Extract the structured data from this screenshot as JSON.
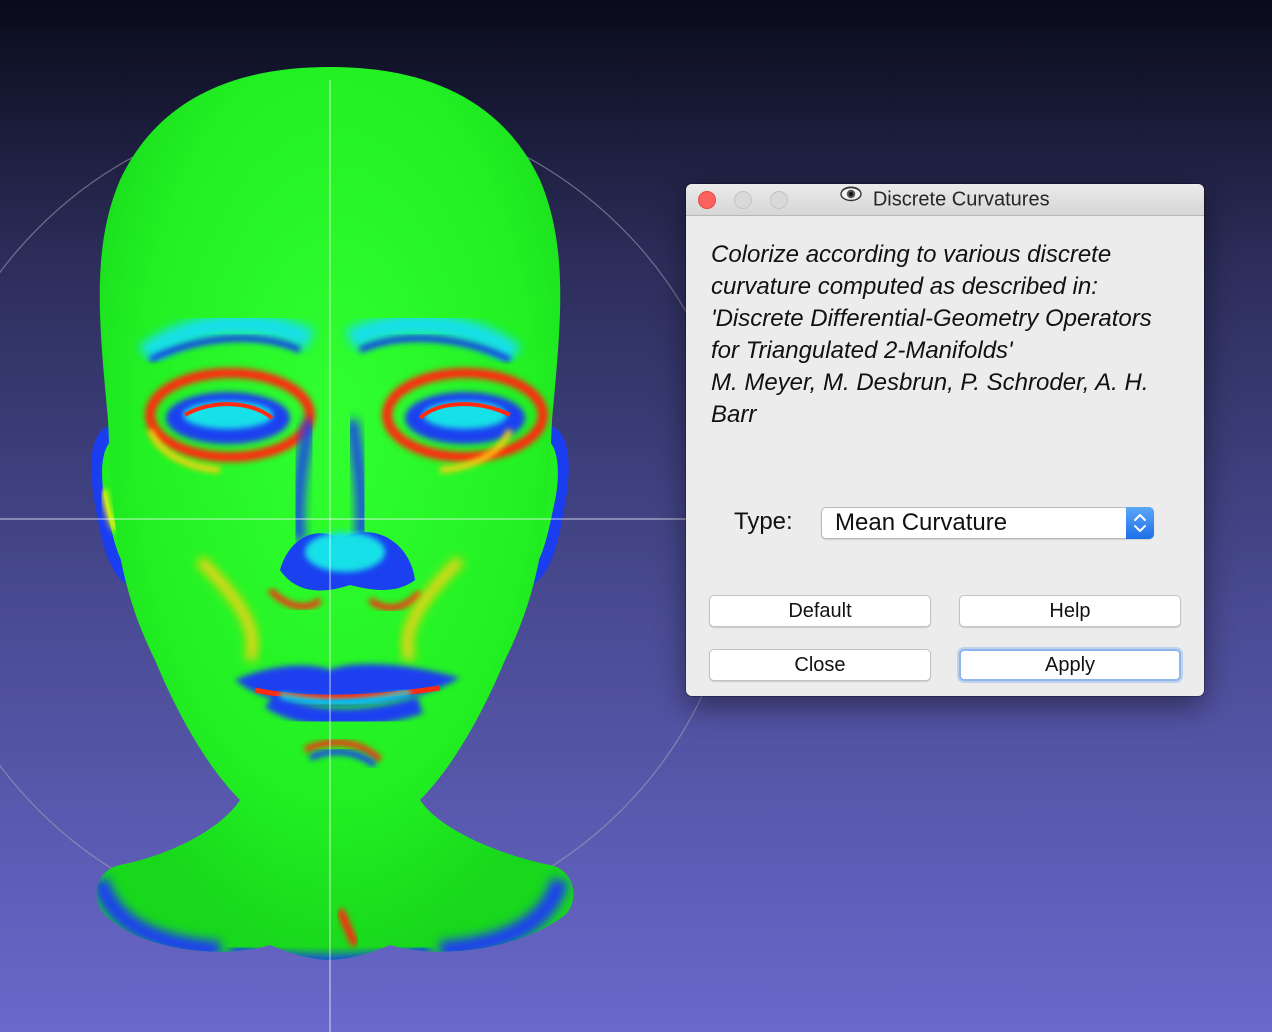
{
  "viewport": {
    "name": "3d-mesh-viewport",
    "colors": {
      "background_top": "#090b1a",
      "background_bottom": "#6a68cc",
      "base": "#22ee22",
      "highlight_red": "#ff2a10",
      "highlight_blue": "#1030ee",
      "highlight_cyan": "#10e8e8"
    }
  },
  "dialog": {
    "title": "Discrete Curvatures",
    "description": "Colorize according to various discrete curvature computed as described in:\n'Discrete Differential-Geometry Operators for Triangulated 2-Manifolds'\nM. Meyer, M. Desbrun, P. Schroder, A. H. Barr",
    "type_label": "Type:",
    "type_value": "Mean Curvature",
    "buttons": {
      "default": "Default",
      "help": "Help",
      "close": "Close",
      "apply": "Apply"
    },
    "icons": {
      "app": "meshlab-eye-icon",
      "select": "up-down-chevron-icon"
    }
  }
}
